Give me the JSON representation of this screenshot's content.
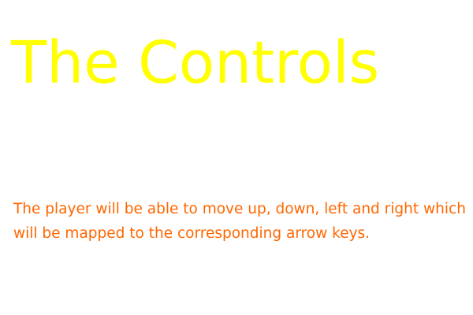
{
  "slide": {
    "title": "The Controls",
    "body": "The player will be able to move up, down, left and right which will be mapped to the corresponding arrow keys."
  },
  "colors": {
    "background": "#ffffff",
    "title": "#ffff00",
    "body": "#ff6600"
  }
}
